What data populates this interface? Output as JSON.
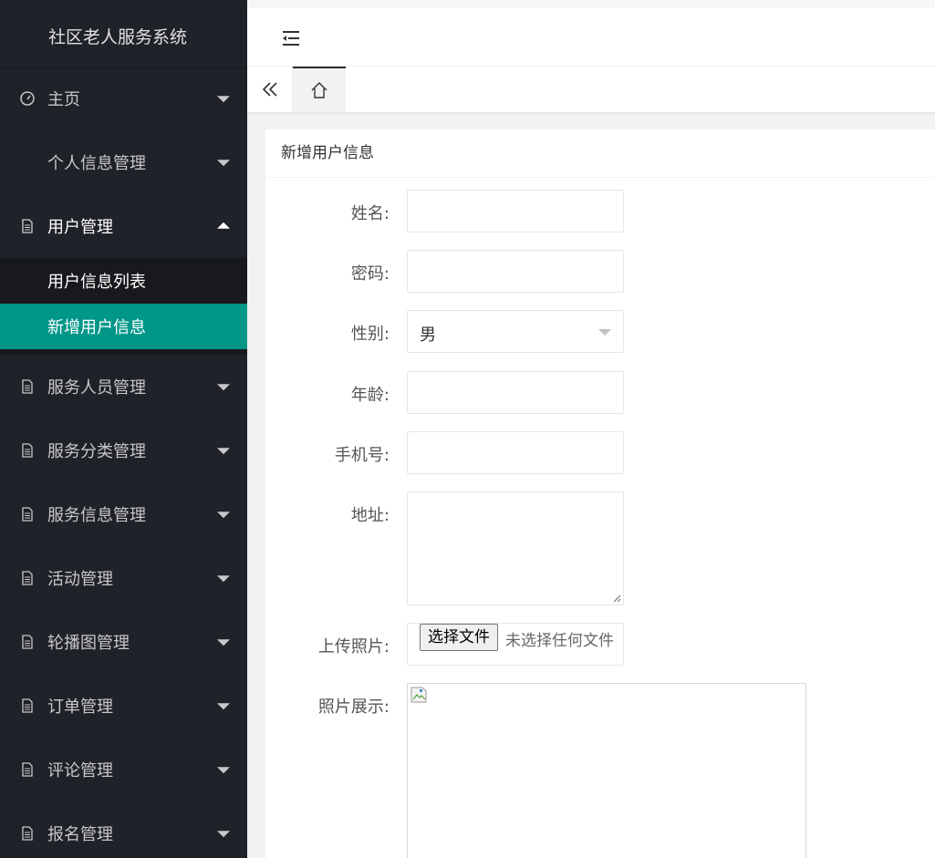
{
  "sidebar": {
    "title": "社区老人服务系统",
    "items": [
      {
        "label": "主页",
        "icon": "dashboard-icon"
      },
      {
        "label": "个人信息管理",
        "icon": ""
      },
      {
        "label": "用户管理",
        "icon": "document-icon",
        "submenu": [
          "用户信息列表",
          "新增用户信息"
        ],
        "active_sub": "新增用户信息"
      },
      {
        "label": "服务人员管理",
        "icon": "document-icon"
      },
      {
        "label": "服务分类管理",
        "icon": "document-icon"
      },
      {
        "label": "服务信息管理",
        "icon": "document-icon"
      },
      {
        "label": "活动管理",
        "icon": "document-icon"
      },
      {
        "label": "轮播图管理",
        "icon": "document-icon"
      },
      {
        "label": "订单管理",
        "icon": "document-icon"
      },
      {
        "label": "评论管理",
        "icon": "document-icon"
      },
      {
        "label": "报名管理",
        "icon": "document-icon"
      }
    ]
  },
  "header": {
    "toggle_icon": "menu-fold-icon"
  },
  "tabs": {
    "back_icon": "double-chevron-left-icon",
    "home_icon": "home-icon"
  },
  "form": {
    "title": "新增用户信息",
    "name_label": "姓名:",
    "name_value": "",
    "password_label": "密码:",
    "password_value": "",
    "gender_label": "性别:",
    "gender_value": "男",
    "age_label": "年龄:",
    "age_value": "",
    "phone_label": "手机号:",
    "phone_value": "",
    "address_label": "地址:",
    "address_value": "",
    "upload_label": "上传照片:",
    "upload_button": "选择文件",
    "upload_status": "未选择任何文件",
    "photo_label": "照片展示:"
  },
  "colors": {
    "sidebar_bg": "#20222a",
    "submenu_bg": "#18191d",
    "active_accent": "#009688"
  }
}
